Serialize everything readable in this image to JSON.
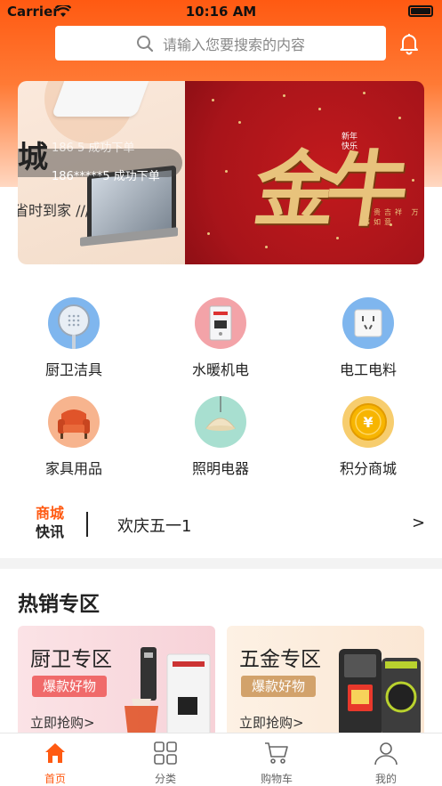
{
  "status_bar": {
    "carrier": "Carrier",
    "time": "10:16 AM"
  },
  "search": {
    "placeholder": "请输入您要搜索的内容"
  },
  "banner": {
    "left_big_char": "城",
    "marquee_line_1": "186      5 成功下单",
    "marquee_line_2": "186*****5 成功下单",
    "slogan": "省时到家 ///",
    "right_tag": "新年\n快乐",
    "right_art_text": "金牛",
    "right_small_text": "富贵吉祥 万事如意"
  },
  "categories": [
    {
      "label": "厨卫洁具",
      "icon": "showerhead-icon"
    },
    {
      "label": "水暖机电",
      "icon": "water-heater-icon"
    },
    {
      "label": "电工电料",
      "icon": "power-socket-icon"
    },
    {
      "label": "家具用品",
      "icon": "armchair-icon"
    },
    {
      "label": "照明电器",
      "icon": "lamp-icon"
    },
    {
      "label": "积分商城",
      "icon": "coin-icon"
    }
  ],
  "news": {
    "tag_line_1": "商城",
    "tag_line_2": "快讯",
    "text": "欢庆五一1",
    "arrow": ">"
  },
  "hot_section": {
    "title": "热销专区"
  },
  "promos": [
    {
      "title": "厨卫专区",
      "badge": "爆款好物",
      "cta": "立即抢购>",
      "badge_color": "#f06a6a"
    },
    {
      "title": "五金专区",
      "badge": "爆款好物",
      "cta": "立即抢购>",
      "badge_color": "#d2a26b"
    }
  ],
  "tabbar": [
    {
      "label": "首页",
      "icon": "home-icon",
      "active": true
    },
    {
      "label": "分类",
      "icon": "grid-icon",
      "active": false
    },
    {
      "label": "购物车",
      "icon": "cart-icon",
      "active": false
    },
    {
      "label": "我的",
      "icon": "user-icon",
      "active": false
    }
  ],
  "colors": {
    "accent": "#ff5a12",
    "text": "#222222"
  }
}
